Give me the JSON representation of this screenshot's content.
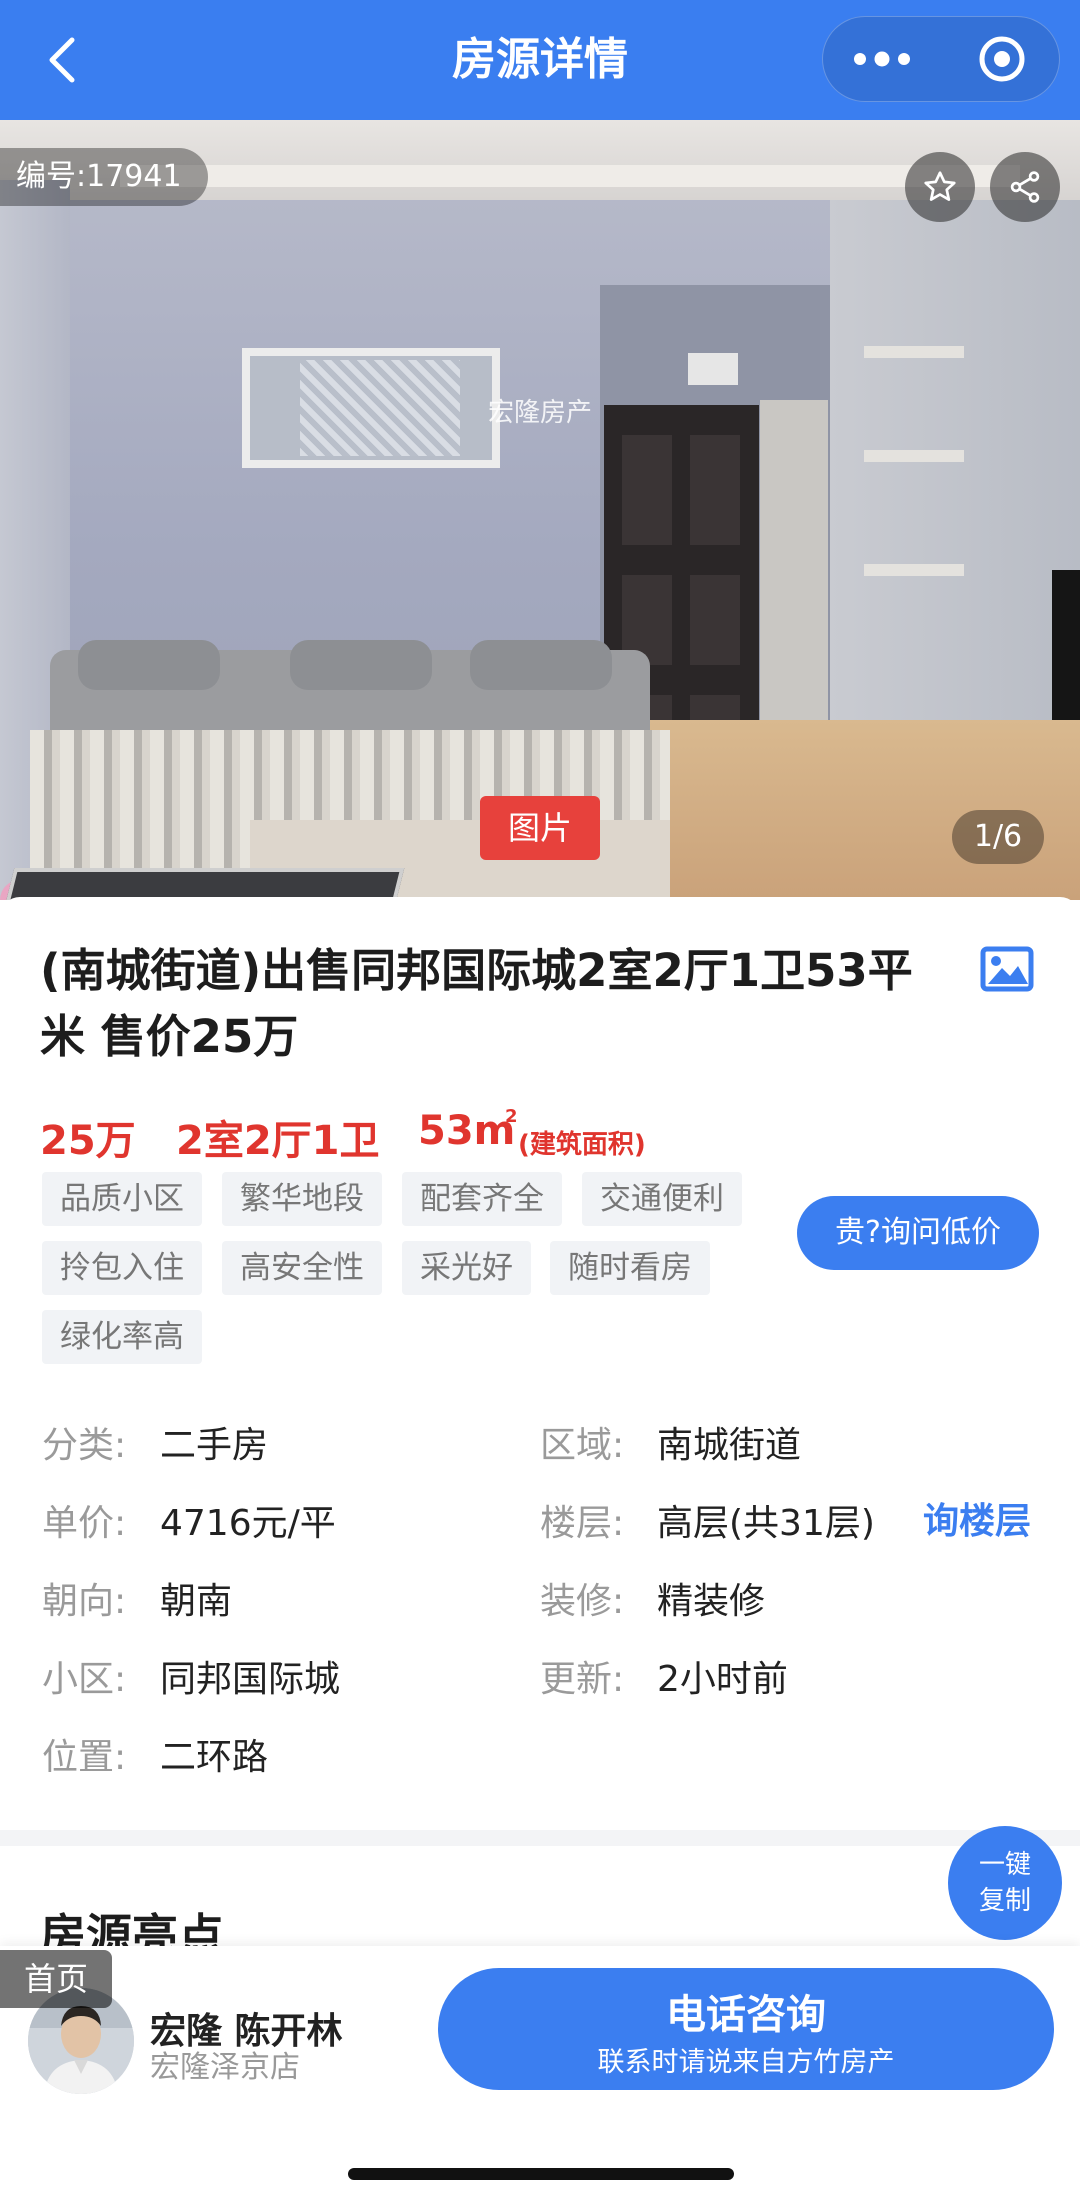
{
  "nav": {
    "title": "房源详情",
    "back_icon": "chevron-left-icon",
    "more_icon": "more-dots-icon",
    "close_icon": "target-close-icon",
    "bg_color": "#3a7ef0"
  },
  "hero": {
    "listing_id": "编号:17941",
    "watermark": "宏隆房产",
    "photo_tag": "图片",
    "photo_counter": "1/6",
    "fav_icon": "star-icon",
    "share_icon": "share-icon"
  },
  "listing": {
    "title": "(南城街道)出售同邦国际城2室2厅1卫53平米 售价25万",
    "gallery_icon": "image-gallery-icon",
    "price": "25万",
    "layout": "2室2厅1卫",
    "area_value": "53m",
    "area_sup": "2",
    "area_label": "(建筑面积)",
    "accent_color": "#e0352e",
    "tags": [
      "品质小区",
      "繁华地段",
      "配套齐全",
      "交通便利",
      "拎包入住",
      "高安全性",
      "采光好",
      "随时看房",
      "绿化率高"
    ],
    "ask_price_button": "贵?询问低价",
    "attributes_left": [
      {
        "label": "分类:",
        "value": "二手房"
      },
      {
        "label": "单价:",
        "value": "4716元/平"
      },
      {
        "label": "朝向:",
        "value": "朝南"
      },
      {
        "label": "小区:",
        "value": "同邦国际城"
      },
      {
        "label": "位置:",
        "value": "二环路"
      }
    ],
    "attributes_right": [
      {
        "label": "区域:",
        "value": "南城街道"
      },
      {
        "label": "楼层:",
        "value": "高层(共31层)"
      },
      {
        "label": "装修:",
        "value": "精装修"
      },
      {
        "label": "更新:",
        "value": "2小时前"
      }
    ],
    "ask_floor_link": "询楼层"
  },
  "highlights": {
    "heading": "房源亮点"
  },
  "copy_fab": {
    "line1": "一键",
    "line2": "复制"
  },
  "bottom": {
    "home_tab": "首页",
    "agent_name": "宏隆 陈开林",
    "agent_store": "宏隆泽京店",
    "call_title": "电话咨询",
    "call_subtitle": "联系时请说来自方竹房产",
    "button_color": "#3b7ef0"
  }
}
